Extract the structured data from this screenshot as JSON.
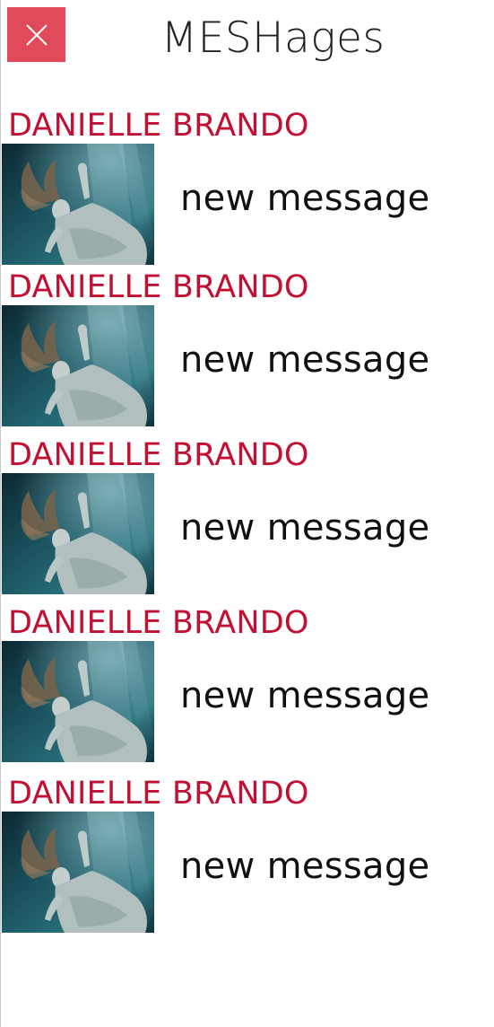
{
  "header": {
    "title": "MESHages",
    "close_icon": "close-icon"
  },
  "colors": {
    "close_button_bg": "#e04a5a",
    "sender_name": "#c21033",
    "title_text": "#222222",
    "message_text": "#111111"
  },
  "messages": [
    {
      "sender": "DANIELLE BRANDO",
      "preview": "new message",
      "avatar": "underwater-woman-photo"
    },
    {
      "sender": "DANIELLE BRANDO",
      "preview": "new message",
      "avatar": "underwater-woman-photo"
    },
    {
      "sender": "DANIELLE BRANDO",
      "preview": "new message",
      "avatar": "underwater-woman-photo"
    },
    {
      "sender": "DANIELLE BRANDO",
      "preview": "new message",
      "avatar": "underwater-woman-photo"
    },
    {
      "sender": "DANIELLE BRANDO",
      "preview": "new message",
      "avatar": "underwater-woman-photo"
    }
  ]
}
